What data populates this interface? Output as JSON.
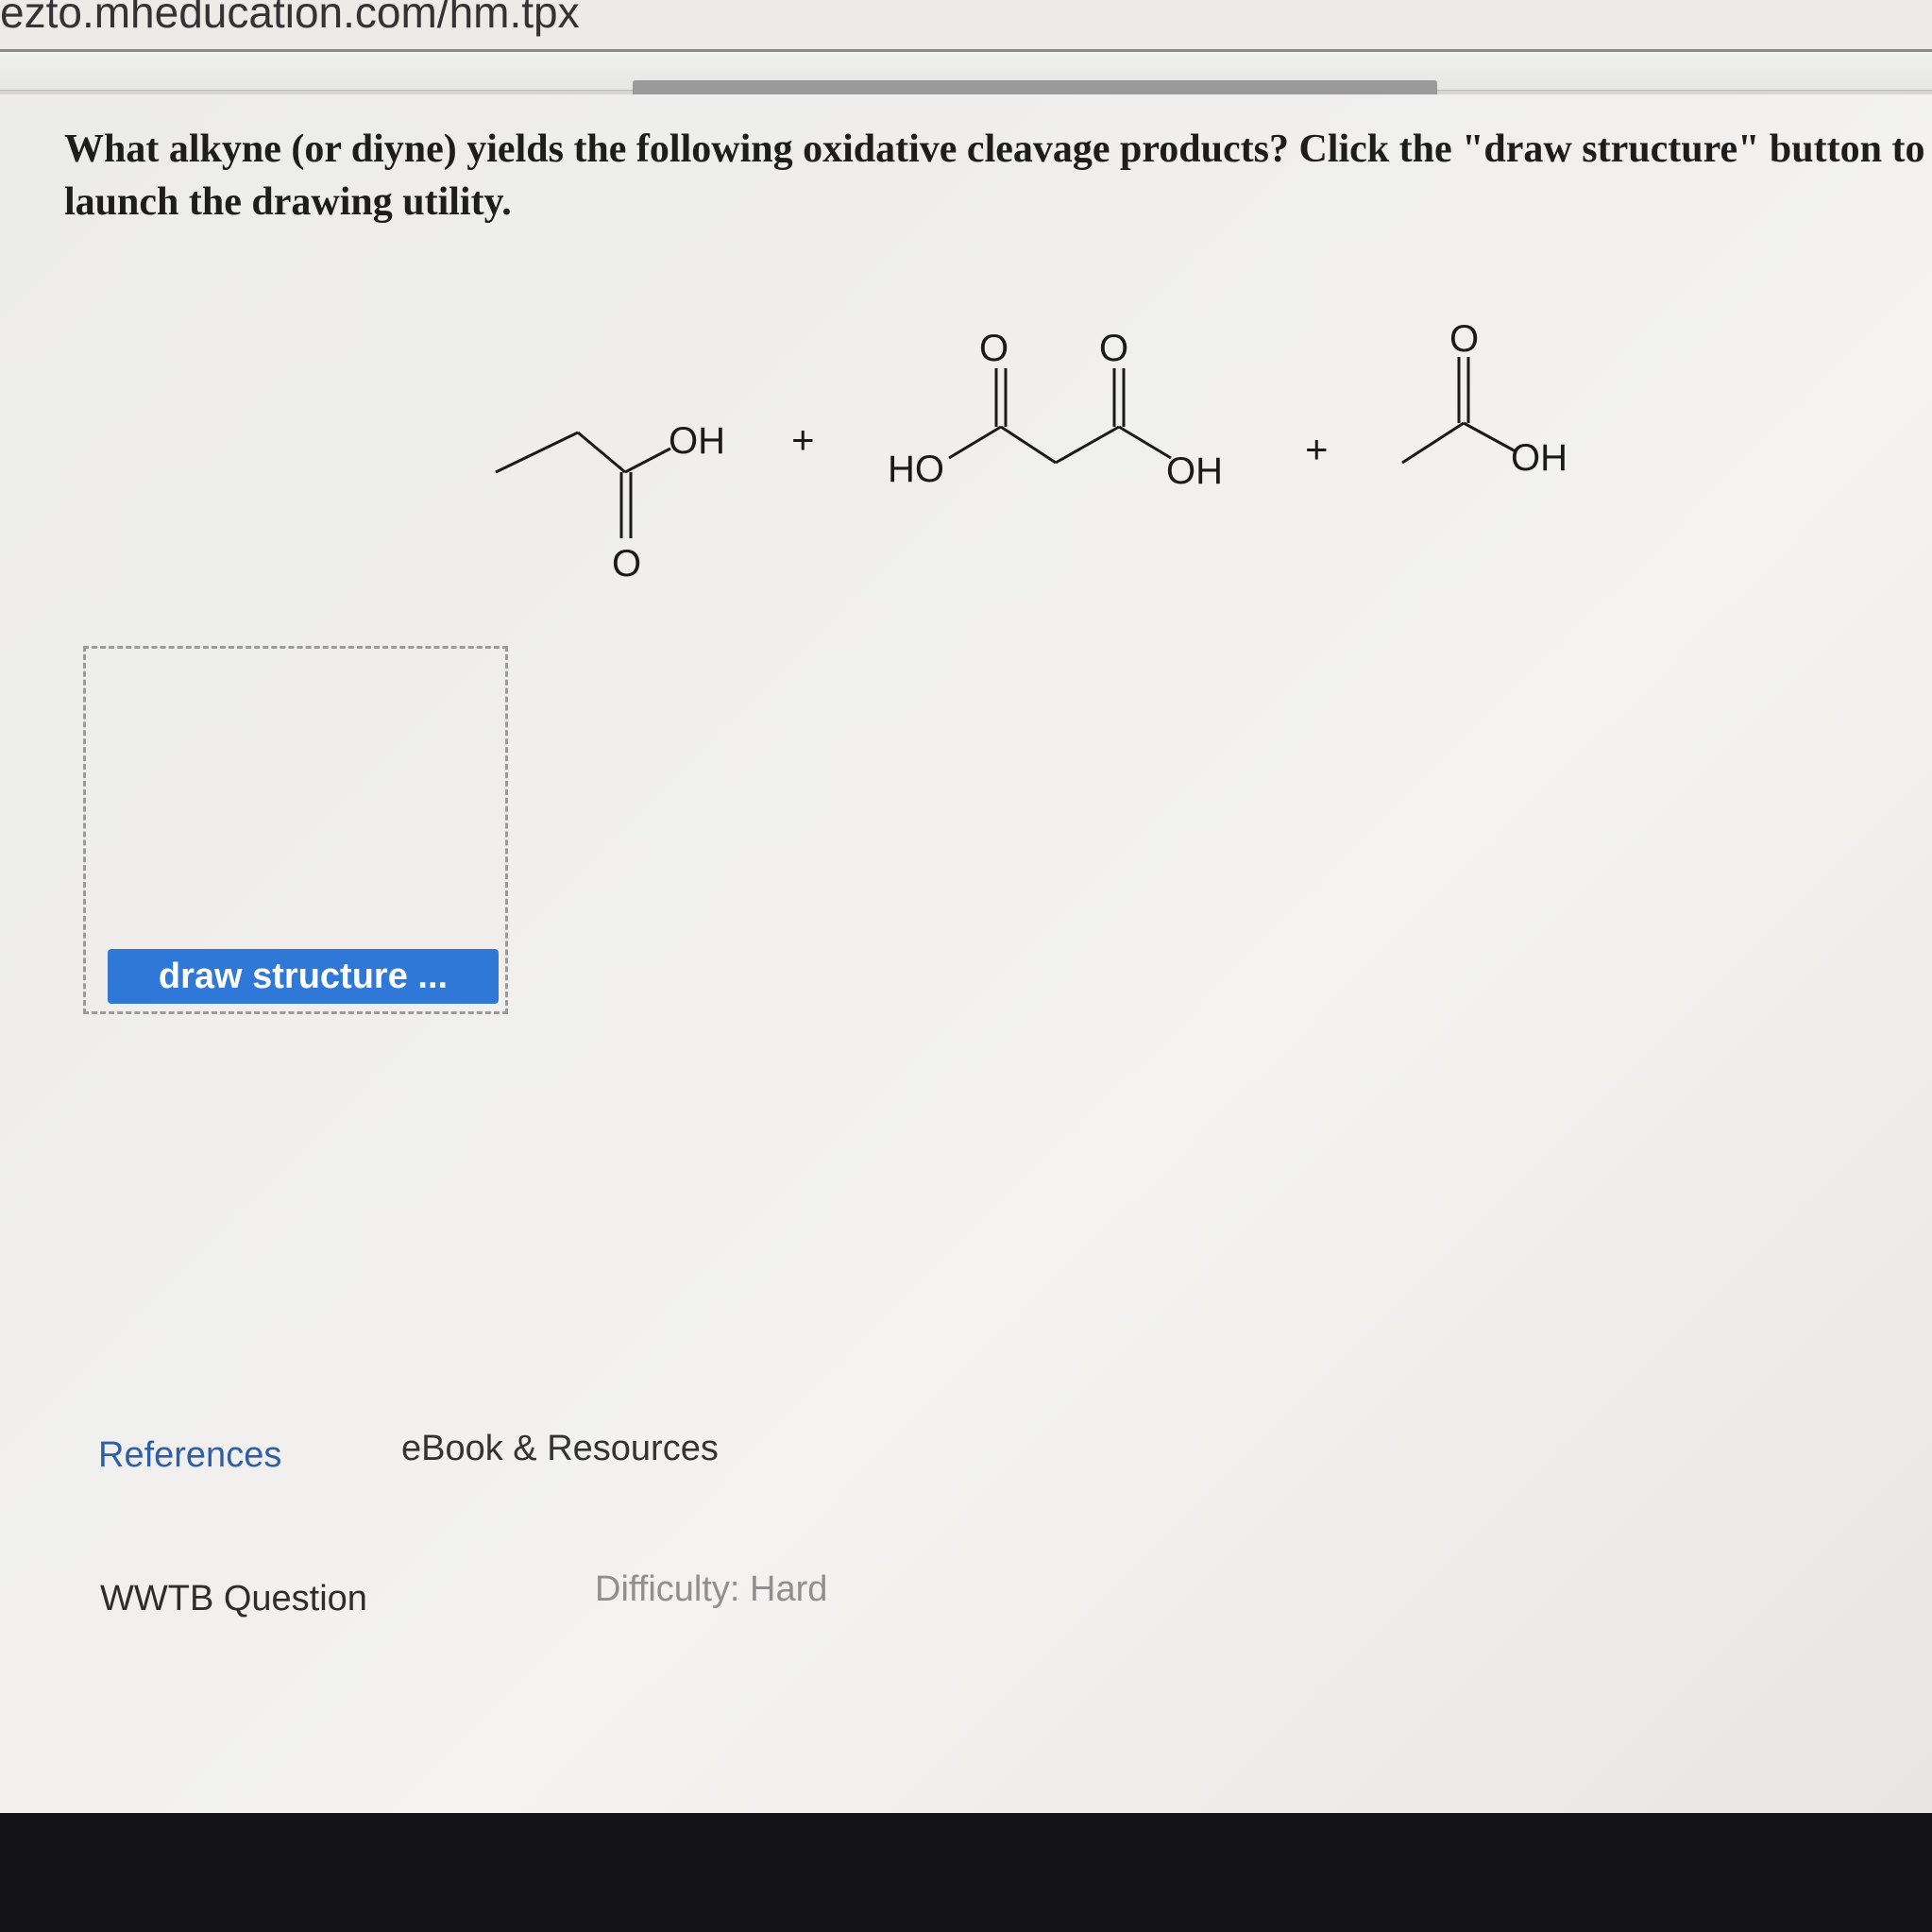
{
  "browser": {
    "url": "ezto.mheducation.com/hm.tpx"
  },
  "question": {
    "text": "What alkyne (or diyne) yields the following oxidative cleavage products? Click the \"draw structure\" button to launch the drawing utility."
  },
  "reaction": {
    "product1": {
      "oh": "OH",
      "o": "O"
    },
    "plus1": "+",
    "product2": {
      "ho": "HO",
      "o_left": "O",
      "o_right": "O",
      "oh": "OH"
    },
    "plus2": "+",
    "product3": {
      "o": "O",
      "oh": "OH"
    }
  },
  "draw_button": {
    "label": "draw structure ..."
  },
  "footer": {
    "references": "References",
    "ebook": "eBook & Resources",
    "question_type": "WWTB Question",
    "difficulty": "Difficulty: Hard"
  },
  "colors": {
    "button": "#2f78d8",
    "link": "#2c5fa8",
    "bezel": "#141316"
  }
}
